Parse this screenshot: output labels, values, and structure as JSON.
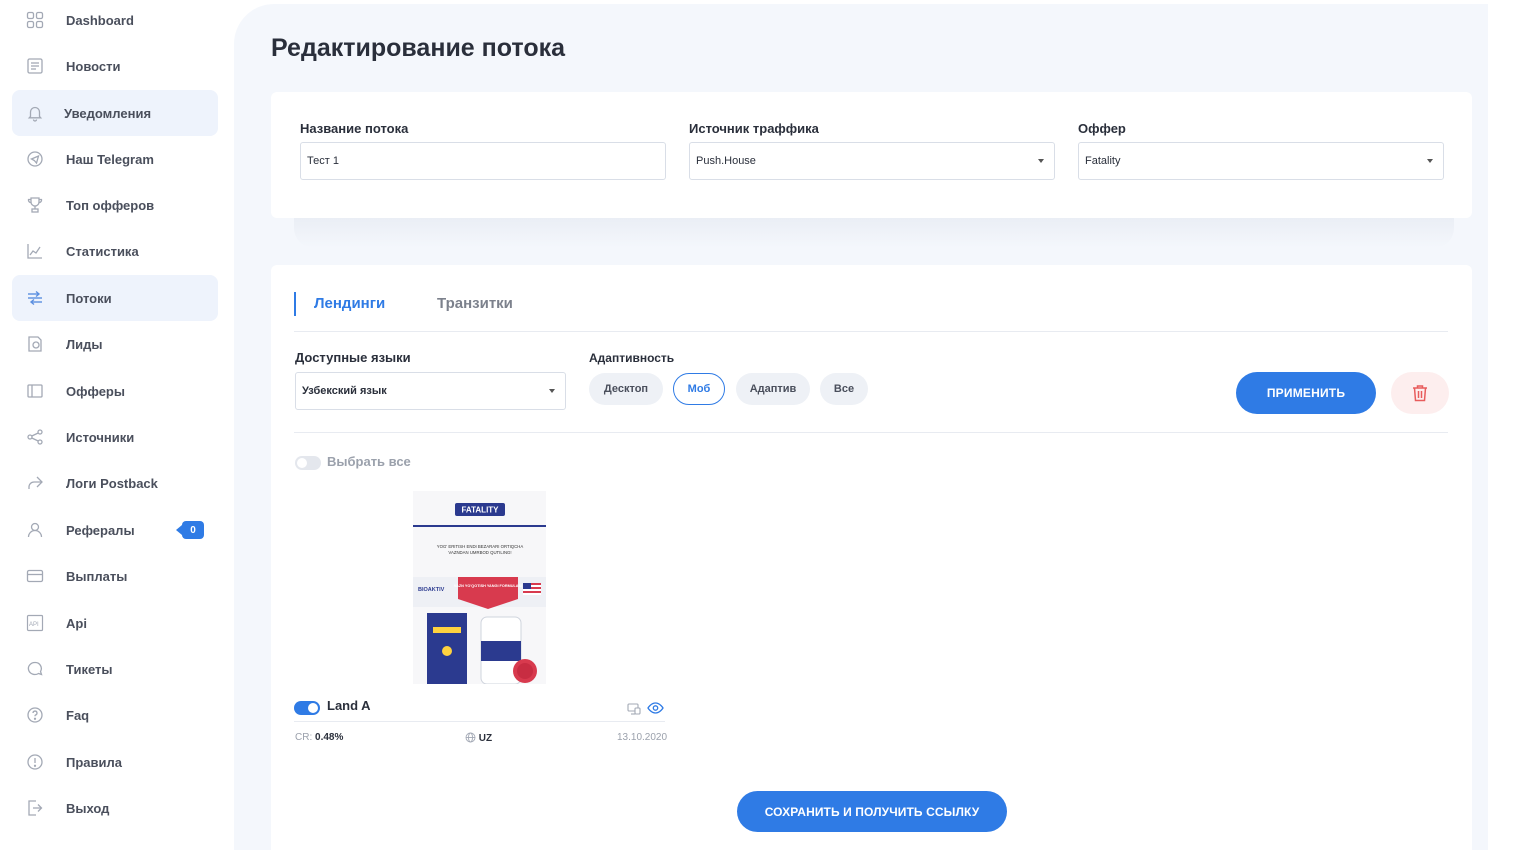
{
  "sidebar": {
    "items": [
      {
        "label": "Dashboard",
        "icon": "dashboard-icon"
      },
      {
        "label": "Новости",
        "icon": "news-icon"
      },
      {
        "label": "Уведомления",
        "icon": "bell-icon"
      },
      {
        "label": "Наш Telegram",
        "icon": "telegram-icon"
      },
      {
        "label": "Топ офферов",
        "icon": "trophy-icon"
      },
      {
        "label": "Статистика",
        "icon": "chart-icon"
      },
      {
        "label": "Потоки",
        "icon": "streams-icon"
      },
      {
        "label": "Лиды",
        "icon": "leads-icon"
      },
      {
        "label": "Офферы",
        "icon": "offers-icon"
      },
      {
        "label": "Источники",
        "icon": "share-icon"
      },
      {
        "label": "Логи Postback",
        "icon": "forward-icon"
      },
      {
        "label": "Рефералы",
        "icon": "user-icon",
        "badge": "0"
      },
      {
        "label": "Выплаты",
        "icon": "card-icon"
      },
      {
        "label": "Api",
        "icon": "api-icon"
      },
      {
        "label": "Тикеты",
        "icon": "chat-icon"
      },
      {
        "label": "Faq",
        "icon": "question-icon"
      },
      {
        "label": "Правила",
        "icon": "info-icon"
      },
      {
        "label": "Выход",
        "icon": "logout-icon"
      }
    ],
    "active": [
      "Уведомления",
      "Потоки"
    ]
  },
  "page": {
    "title": "Редактирование потока"
  },
  "form": {
    "name_label": "Название потока",
    "name_value": "Тест 1",
    "source_label": "Источник траффика",
    "source_value": "Push.House",
    "offer_label": "Оффер",
    "offer_value": "Fatality"
  },
  "tabs": {
    "landings": "Лендинги",
    "transits": "Транзитки"
  },
  "filters": {
    "languages_label": "Доступные языки",
    "languages_value": "Узбекский язык",
    "adaptive_label": "Адаптивность",
    "chips": [
      "Десктоп",
      "Моб",
      "Адаптив",
      "Все"
    ],
    "selected_chip": "Моб",
    "apply_label": "ПРИМЕНИТЬ"
  },
  "select_all_label": "Выбрать все",
  "landing": {
    "name": "Land A",
    "cr_label": "CR:",
    "cr_value": "0.48%",
    "geo": "UZ",
    "date": "13.10.2020",
    "image": {
      "brand": "FATALITY",
      "tagline_1": "YOG' ERITISH ENDI BEZARARI ORTIQCHA",
      "tagline_2": "VAZNDAN UMRBOD QUTILING!",
      "badge_left": "BIOAKTIV",
      "banner": "VAZN YO'QOTISH YANGI FORMULASI"
    }
  },
  "save_label": "СОХРАНИТЬ И ПОЛУЧИТЬ ССЫЛКУ",
  "colors": {
    "accent": "#2f7be5",
    "background": "#f4f7fc",
    "danger": "#e85c5c"
  }
}
